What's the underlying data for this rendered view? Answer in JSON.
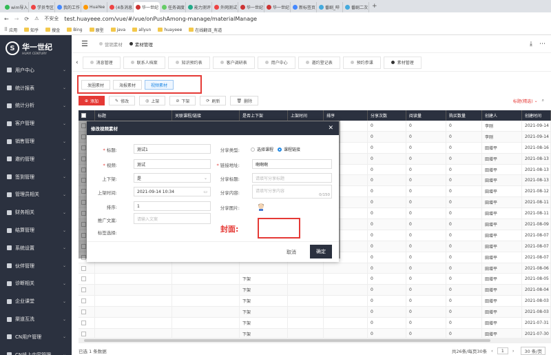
{
  "browser": {
    "tabs": [
      "wim导入",
      "学员专区",
      "我的工作",
      "HuaYee",
      "(4条消息",
      "华一世纪",
      "任务调度",
      "能力测评",
      "外网测试",
      "华一世纪",
      "华一世纪",
      "新标签页",
      "番剧_哔",
      "番剧二次"
    ],
    "security": "不安全",
    "url": "test.huayeee.com/vue/#/vue/onPushAmong-manage/materialManage",
    "bookmarks": [
      "应用",
      "知乎",
      "搜金",
      "Bing",
      "原型",
      "java",
      "allyun",
      "huayeee",
      "在线翻译_有道"
    ]
  },
  "logo": {
    "mark": "S",
    "name": "华一世纪",
    "en": "HUAYI CENTURY"
  },
  "sidebar": [
    "用户中心",
    "统计报表",
    "统计分析",
    "客户管理",
    "销售管理",
    "邀约管理",
    "签到管理",
    "管理员相关",
    "财务相关",
    "结算管理",
    "系统设置",
    "伙伴管理",
    "诊断相关",
    "企业课堂",
    "渠道互洗",
    "CN用户管理",
    "CN线上内容管理"
  ],
  "header": {
    "crumb1": "营销素材",
    "crumb2": "素材管理"
  },
  "page_tabs": [
    "消息管理",
    "联系人档案",
    "知识预约表",
    "客户调研表",
    "用户中心",
    "邀约登记表",
    "预约参课",
    "素材管理"
  ],
  "sub_tabs": [
    "发圈素材",
    "海报素材",
    "视频素材"
  ],
  "toolbar": {
    "add": "添加",
    "edit": "修改",
    "up": "上架",
    "down": "下架",
    "refresh": "刷新",
    "delete": "删除",
    "filter": "标题(精选)"
  },
  "columns": [
    "标题",
    "关联课程/链接",
    "是否上下架",
    "上架时间",
    "排序",
    "分享次数",
    "阅读量",
    "购买数量",
    "创建人",
    "创建时间"
  ],
  "rows": [
    {
      "status": "",
      "share": "0",
      "read": "0",
      "buy": "0",
      "creator": "李刚",
      "time": "2021-09-14"
    },
    {
      "status": "",
      "share": "0",
      "read": "0",
      "buy": "0",
      "creator": "李刚",
      "time": "2021-09-14"
    },
    {
      "status": "",
      "share": "0",
      "read": "0",
      "buy": "0",
      "creator": "田增平",
      "time": "2021-08-16"
    },
    {
      "status": "",
      "share": "0",
      "read": "0",
      "buy": "0",
      "creator": "田增平",
      "time": "2021-08-13"
    },
    {
      "status": "",
      "share": "0",
      "read": "0",
      "buy": "0",
      "creator": "田增平",
      "time": "2021-08-13"
    },
    {
      "status": "",
      "share": "0",
      "read": "0",
      "buy": "0",
      "creator": "田增平",
      "time": "2021-08-13"
    },
    {
      "status": "",
      "share": "0",
      "read": "0",
      "buy": "0",
      "creator": "田增平",
      "time": "2021-08-12"
    },
    {
      "status": "",
      "share": "0",
      "read": "0",
      "buy": "0",
      "creator": "田增平",
      "time": "2021-08-11"
    },
    {
      "status": "",
      "share": "0",
      "read": "0",
      "buy": "0",
      "creator": "田增平",
      "time": "2021-08-11"
    },
    {
      "status": "",
      "share": "0",
      "read": "0",
      "buy": "0",
      "creator": "田增平",
      "time": "2021-08-09"
    },
    {
      "status": "",
      "share": "0",
      "read": "0",
      "buy": "0",
      "creator": "田增平",
      "time": "2021-08-07"
    },
    {
      "status": "",
      "share": "0",
      "read": "0",
      "buy": "0",
      "creator": "田增平",
      "time": "2021-08-07"
    },
    {
      "status": "",
      "share": "0",
      "read": "0",
      "buy": "0",
      "creator": "田增平",
      "time": "2021-08-07"
    },
    {
      "status": "",
      "share": "0",
      "read": "0",
      "buy": "0",
      "creator": "田增平",
      "time": "2021-08-06"
    },
    {
      "status": "下架",
      "share": "0",
      "read": "0",
      "buy": "0",
      "creator": "田增平",
      "time": "2021-08-05"
    },
    {
      "status": "下架",
      "share": "0",
      "read": "0",
      "buy": "0",
      "creator": "田增平",
      "time": "2021-08-04"
    },
    {
      "status": "下架",
      "share": "0",
      "read": "0",
      "buy": "0",
      "creator": "田增平",
      "time": "2021-08-03"
    },
    {
      "status": "下架",
      "share": "0",
      "read": "0",
      "buy": "0",
      "creator": "田增平",
      "time": "2021-08-03"
    },
    {
      "status": "下架",
      "share": "0",
      "read": "0",
      "buy": "0",
      "creator": "田增平",
      "time": "2021-07-31"
    },
    {
      "status": "下架",
      "share": "0",
      "read": "0",
      "buy": "0",
      "creator": "田增平",
      "time": "2021-07-30"
    }
  ],
  "footer": {
    "selected": "已选 1 条数据",
    "total": "共26条/每页30条",
    "page": "1",
    "per_page": "30 条/页"
  },
  "dialog": {
    "title": "修改视频素材",
    "title_label": "标题:",
    "title_value": "测试1",
    "video_label": "视频:",
    "video_value": "测试",
    "shelf_label": "上下架:",
    "shelf_value": "是",
    "shelf_time_label": "上架时间:",
    "shelf_time_value": "2021-09-14 10:34",
    "sort_label": "排序:",
    "sort_value": "1",
    "promo_label": "推广文案:",
    "promo_placeholder": "请输入文案",
    "tag_label": "标签选择:",
    "share_type_label": "分享类型:",
    "share_opt1": "选择课程",
    "share_opt2": "课程链接",
    "link_label": "链接地址:",
    "link_value": "啊啊啊",
    "share_title_label": "分享标题:",
    "share_title_placeholder": "请填写分享标题",
    "share_content_label": "分享内容:",
    "share_content_placeholder": "请填写分享内容",
    "count": "0/150",
    "share_image_label": "分享图片:",
    "cover_label": "封面:",
    "cancel": "取消",
    "ok": "确定"
  },
  "colors": {
    "sidebar": "#2b313f",
    "accent": "#e53935",
    "link": "#1e88e5"
  }
}
